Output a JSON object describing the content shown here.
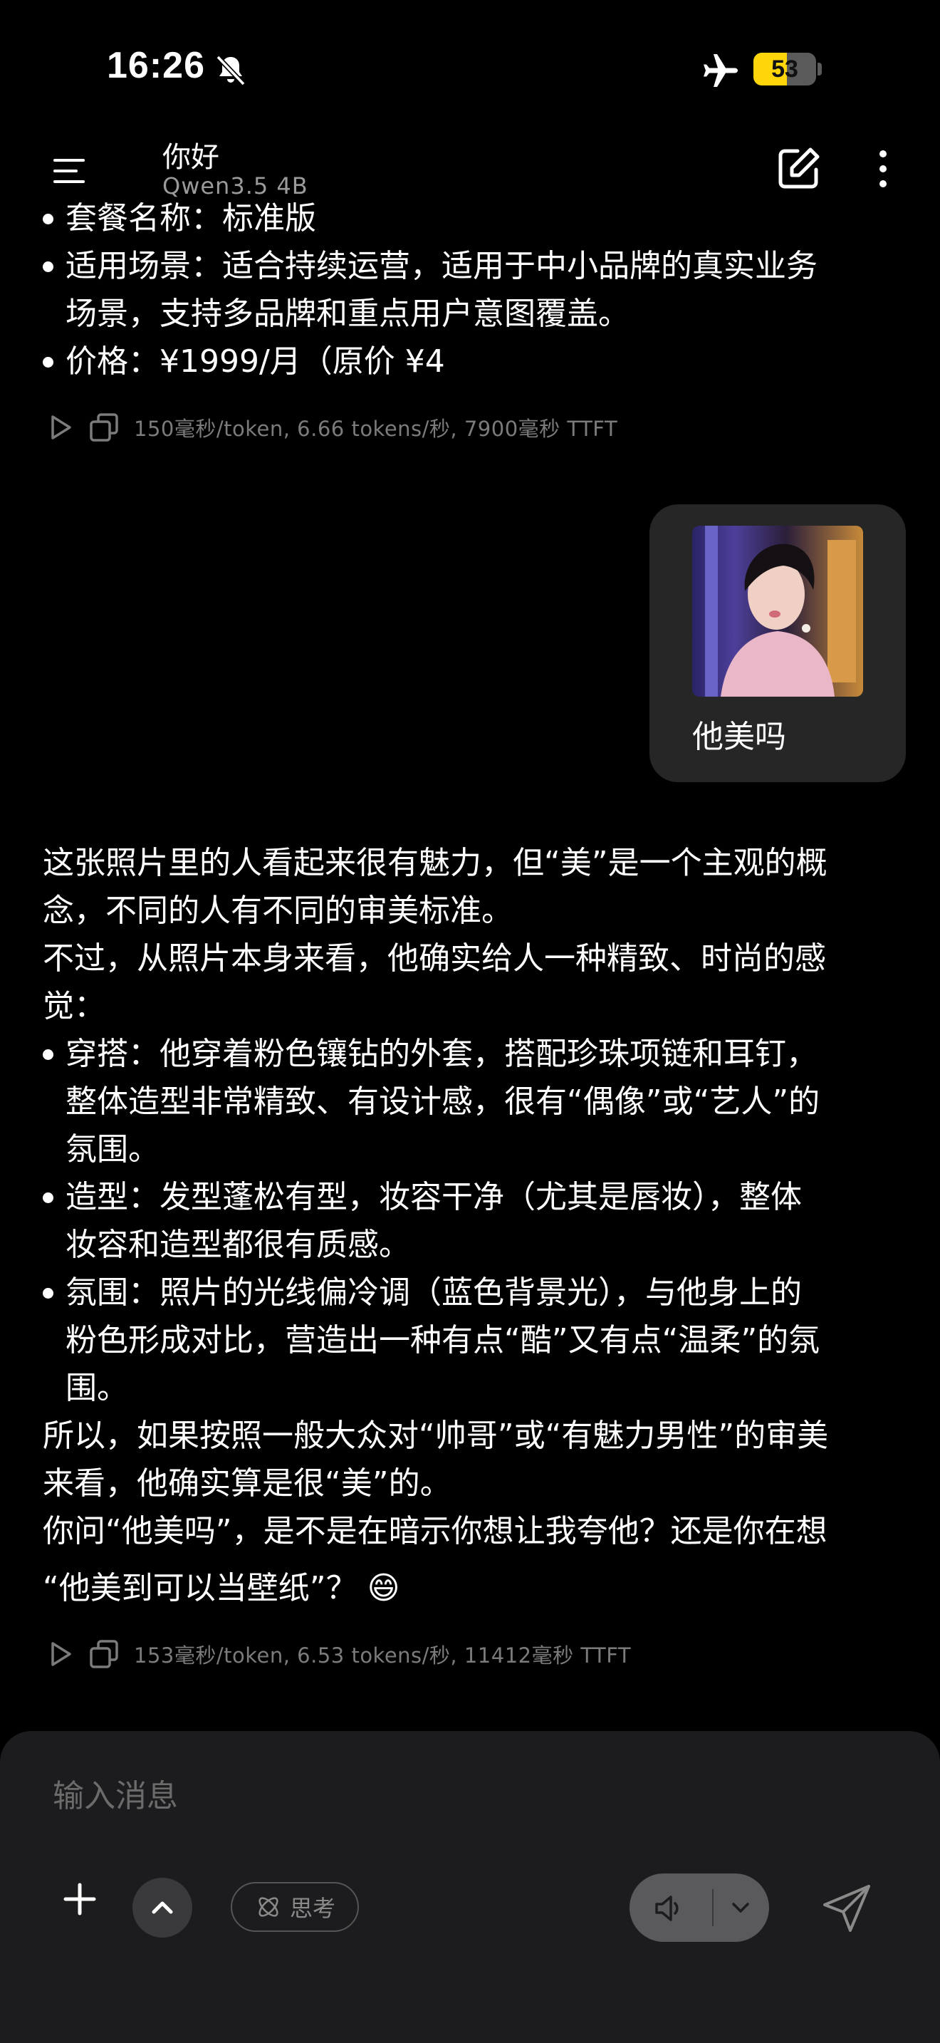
{
  "status_bar": {
    "time": "16:26",
    "battery": "53",
    "battery_level_pct": 53,
    "icons": [
      "bell-slash-icon",
      "airplane-icon",
      "battery-icon"
    ],
    "battery_color": "#ffd60a"
  },
  "header": {
    "title": "你好",
    "model": "Qwen3.5 4B",
    "icons": [
      "menu-icon",
      "edit-icon",
      "more-vertical-icon"
    ]
  },
  "previous_message": {
    "bullets": [
      "套餐名称：标准版",
      "适用场景：适合持续运营，适用于中小品牌的真实业务",
      "场景，支持多品牌和重点用户意图覆盖。",
      "价格：¥1999/月（原价 ¥4"
    ],
    "meta": "150毫秒/token, 6.66 tokens/秒, 7900毫秒 TTFT"
  },
  "user_message": {
    "text": "他美吗",
    "image_icon": "photo-thumbnail"
  },
  "assistant_message": {
    "lines": [
      "这张照片里的人看起来很有魅力，但“美”是一个主观的概",
      "念，不同的人有不同的审美标准。",
      "不过，从照片本身来看，他确实给人一种精致、时尚的感",
      "觉：",
      "穿搭：他穿着粉色镶钻的外套，搭配珍珠项链和耳钉，",
      "整体造型非常精致、有设计感，很有“偶像”或“艺人”的",
      "氛围。",
      "造型：发型蓬松有型，妆容干净（尤其是唇妆），整体",
      "妆容和造型都很有质感。",
      "氛围：照片的光线偏冷调（蓝色背景光），与他身上的",
      "粉色形成对比，营造出一种有点“酷”又有点“温柔”的氛",
      "围。",
      "所以，如果按照一般大众对“帅哥”或“有魅力男性”的审美",
      "来看，他确实算是很“美”的。",
      "你问“他美吗”，是不是在暗示你想让我夸他？还是你在想",
      "“他美到可以当壁纸”？ 😄"
    ],
    "meta": "153毫秒/token, 6.53 tokens/秒, 11412毫秒 TTFT"
  },
  "message_actions": {
    "icons": [
      "play-icon",
      "copy-icon"
    ]
  },
  "composer": {
    "placeholder": "输入消息",
    "think_label": "思考",
    "icons": [
      "plus-icon",
      "chevron-up-icon",
      "atom-icon",
      "speaker-icon",
      "chevron-down-icon",
      "send-icon"
    ]
  }
}
